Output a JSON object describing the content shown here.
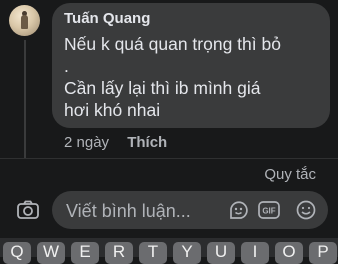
{
  "comment": {
    "author": "Tuấn Quang",
    "lines": [
      "Nếu k quá quan trọng thì bỏ",
      ".",
      "Cần lấy lại thì ib mình giá",
      "hơi khó nhai"
    ],
    "time": "2 ngày",
    "like_label": "Thích"
  },
  "rules_link": "Quy tắc",
  "composer": {
    "placeholder": "Viết bình luận..."
  },
  "icons": {
    "camera": "camera-icon",
    "sticker": "sticker-icon",
    "gif": "gif-icon",
    "emoji": "emoji-icon"
  },
  "keyboard": {
    "keys": [
      "Q",
      "W",
      "E",
      "R",
      "T",
      "Y",
      "U",
      "I",
      "O",
      "P"
    ]
  },
  "colors": {
    "background": "#18191a",
    "bubble": "#3a3b3c",
    "text_primary": "#e4e6eb",
    "text_secondary": "#b0b3b8"
  }
}
